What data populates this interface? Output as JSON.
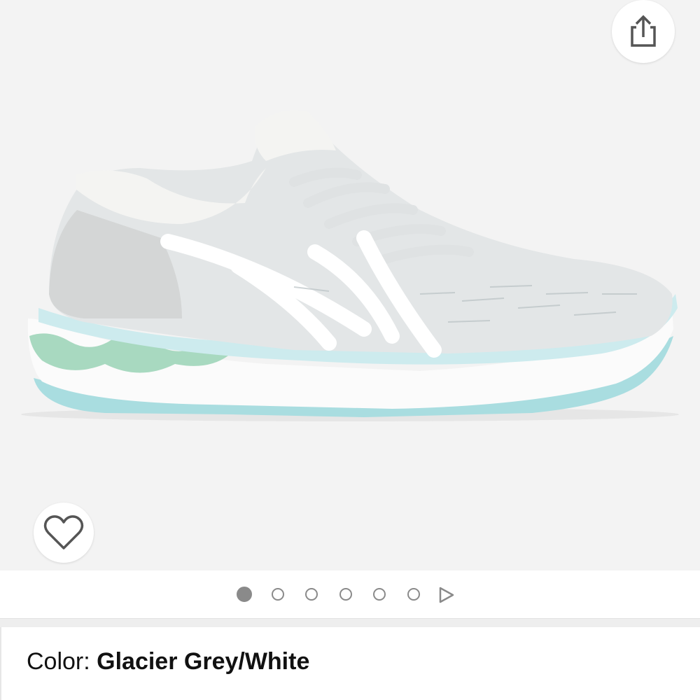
{
  "product_image": {
    "alt_icon": "running-shoe-image",
    "accent_colors": {
      "upper": "#e3e6e7",
      "stripes": "#ffffff",
      "midsole_accent": "#a9dde0",
      "gel_insert": "#a8d9c0"
    }
  },
  "actions": {
    "share_icon": "share-icon",
    "wishlist_icon": "heart-icon"
  },
  "pager": {
    "total_dots": 6,
    "active_index": 0,
    "next_icon": "play-triangle-icon"
  },
  "color_selector": {
    "label": "Color:",
    "value": "Glacier Grey/White"
  }
}
